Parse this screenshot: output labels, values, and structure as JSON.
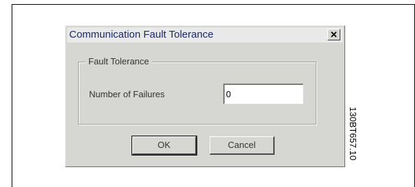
{
  "dialog": {
    "title": "Communication Fault Tolerance",
    "close_icon": "close-icon",
    "close_glyph": "✕",
    "group": {
      "label": "Fault Tolerance",
      "field_label": "Number of Failures",
      "field_value": "0"
    },
    "buttons": {
      "ok_label": "OK",
      "cancel_label": "Cancel"
    }
  },
  "figure_code": "130BT657.10",
  "colors": {
    "dialog_bg": "#d6d6d3",
    "title_text": "#1a2a66"
  }
}
